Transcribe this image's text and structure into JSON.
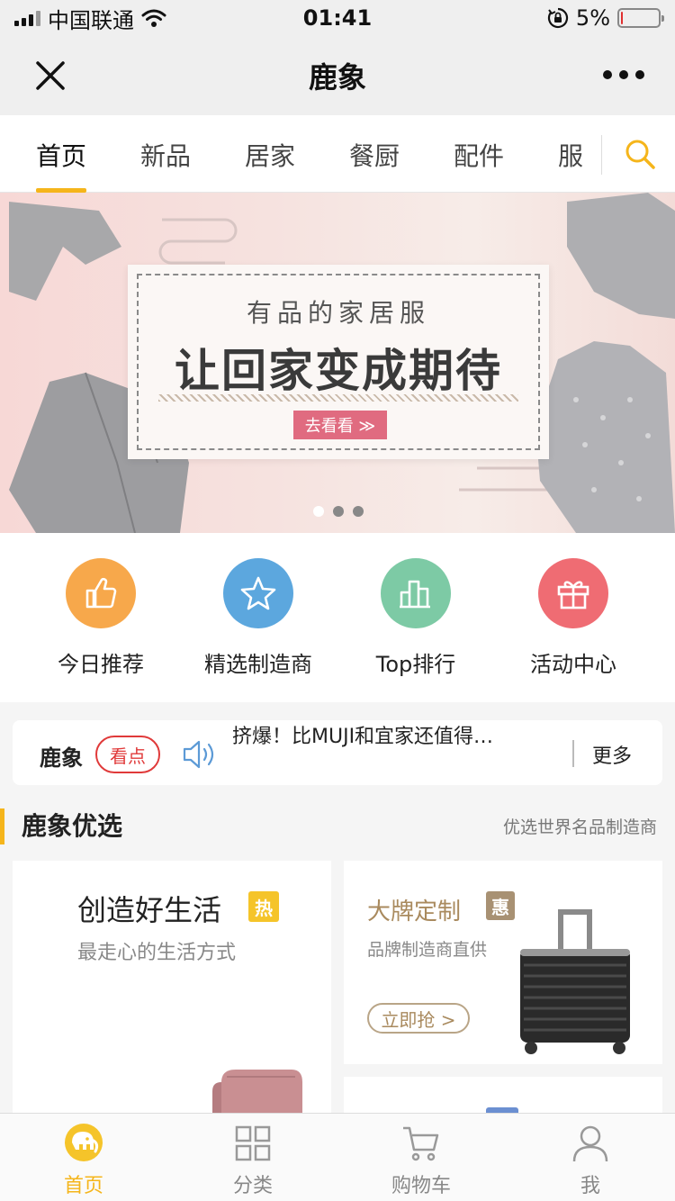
{
  "status_bar": {
    "carrier": "中国联通",
    "time": "01:41",
    "battery": "5%",
    "battery_level": 0.05,
    "icons": [
      "signal-icon",
      "wifi-icon",
      "orientation-lock-icon",
      "battery-icon"
    ]
  },
  "nav": {
    "title": "鹿象",
    "close_icon": "close-icon",
    "more_icon": "more-icon"
  },
  "tabs": {
    "items": [
      {
        "label": "首页",
        "active": true
      },
      {
        "label": "新品",
        "active": false
      },
      {
        "label": "居家",
        "active": false
      },
      {
        "label": "餐厨",
        "active": false
      },
      {
        "label": "配件",
        "active": false
      },
      {
        "label": "服",
        "active": false
      }
    ],
    "search_icon": "search-icon",
    "accent": "#f5b51b"
  },
  "banner": {
    "subtitle": "有品的家居服",
    "title": "让回家变成期待",
    "button": "去看看 ≫",
    "slides": 3,
    "active_slide": 0,
    "button_color": "#e06b80"
  },
  "quick_entries": [
    {
      "label": "今日推荐",
      "icon": "thumbs-up-icon",
      "color": "#f7a84b"
    },
    {
      "label": "精选制造商",
      "icon": "star-icon",
      "color": "#5ca7de"
    },
    {
      "label": "Top排行",
      "icon": "ranking-bars-icon",
      "color": "#7dcaa5"
    },
    {
      "label": "活动中心",
      "icon": "gift-icon",
      "color": "#ef6c73"
    }
  ],
  "ticker": {
    "brand": "鹿象",
    "badge": "看点",
    "speaker_icon": "speaker-icon",
    "text": "挤爆！比MUJI和宜家还值得…",
    "more": "更多",
    "badge_color": "#e03a3a"
  },
  "section": {
    "title": "鹿象优选",
    "subtitle": "优选世界名品制造商"
  },
  "cards": {
    "left": {
      "title": "创造好生活",
      "tag": "热",
      "subtitle": "最走心的生活方式",
      "tag_color": "#f5c42a"
    },
    "right": {
      "title": "大牌定制",
      "tag": "惠",
      "subtitle": "品牌制造商直供",
      "button": "立即抢 >",
      "tag_color": "#a89173"
    }
  },
  "tabbar": {
    "items": [
      {
        "label": "首页",
        "icon": "elephant-home-icon",
        "active": true
      },
      {
        "label": "分类",
        "icon": "grid-icon",
        "active": false
      },
      {
        "label": "购物车",
        "icon": "cart-icon",
        "active": false
      },
      {
        "label": "我",
        "icon": "user-icon",
        "active": false
      }
    ]
  }
}
